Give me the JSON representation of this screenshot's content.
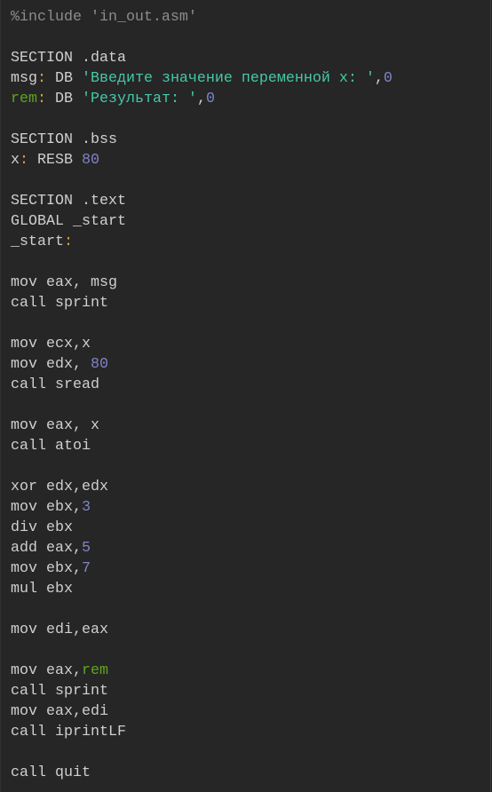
{
  "editor": {
    "lines": [
      [
        [
          "%include 'in_out.asm'",
          "c"
        ]
      ],
      [],
      [
        [
          "SECTION .data",
          "p"
        ]
      ],
      [
        [
          "msg",
          "p"
        ],
        [
          ":",
          "o"
        ],
        [
          " DB ",
          "p"
        ],
        [
          "'Введите значение переменной x: '",
          "s"
        ],
        [
          ",",
          "p"
        ],
        [
          "0",
          "n"
        ]
      ],
      [
        [
          "rem",
          "l"
        ],
        [
          ":",
          "o"
        ],
        [
          " DB ",
          "p"
        ],
        [
          "'Результат: '",
          "s"
        ],
        [
          ",",
          "p"
        ],
        [
          "0",
          "n"
        ]
      ],
      [],
      [
        [
          "SECTION .bss",
          "p"
        ]
      ],
      [
        [
          "x",
          "p"
        ],
        [
          ":",
          "o"
        ],
        [
          " RESB ",
          "p"
        ],
        [
          "80",
          "n"
        ]
      ],
      [],
      [
        [
          "SECTION .text",
          "p"
        ]
      ],
      [
        [
          "GLOBAL _start",
          "p"
        ]
      ],
      [
        [
          "_start",
          "p"
        ],
        [
          ":",
          "o"
        ]
      ],
      [],
      [
        [
          "mov eax, msg",
          "p"
        ]
      ],
      [
        [
          "call sprint",
          "p"
        ]
      ],
      [],
      [
        [
          "mov ecx,x",
          "p"
        ]
      ],
      [
        [
          "mov edx, ",
          "p"
        ],
        [
          "80",
          "n"
        ]
      ],
      [
        [
          "call sread",
          "p"
        ]
      ],
      [],
      [
        [
          "mov eax, x",
          "p"
        ]
      ],
      [
        [
          "call atoi",
          "p"
        ]
      ],
      [],
      [
        [
          "xor edx,edx",
          "p"
        ]
      ],
      [
        [
          "mov ebx,",
          "p"
        ],
        [
          "3",
          "n"
        ]
      ],
      [
        [
          "div ebx",
          "p"
        ]
      ],
      [
        [
          "add eax,",
          "p"
        ],
        [
          "5",
          "n"
        ]
      ],
      [
        [
          "mov ebx,",
          "p"
        ],
        [
          "7",
          "n"
        ]
      ],
      [
        [
          "mul ebx",
          "p"
        ]
      ],
      [],
      [
        [
          "mov edi,eax",
          "p"
        ]
      ],
      [],
      [
        [
          "mov eax,",
          "p"
        ],
        [
          "rem",
          "l"
        ]
      ],
      [
        [
          "call sprint",
          "p"
        ]
      ],
      [
        [
          "mov eax,edi",
          "p"
        ]
      ],
      [
        [
          "call iprintLF",
          "p"
        ]
      ],
      [],
      [
        [
          "call quit",
          "p"
        ]
      ]
    ]
  }
}
